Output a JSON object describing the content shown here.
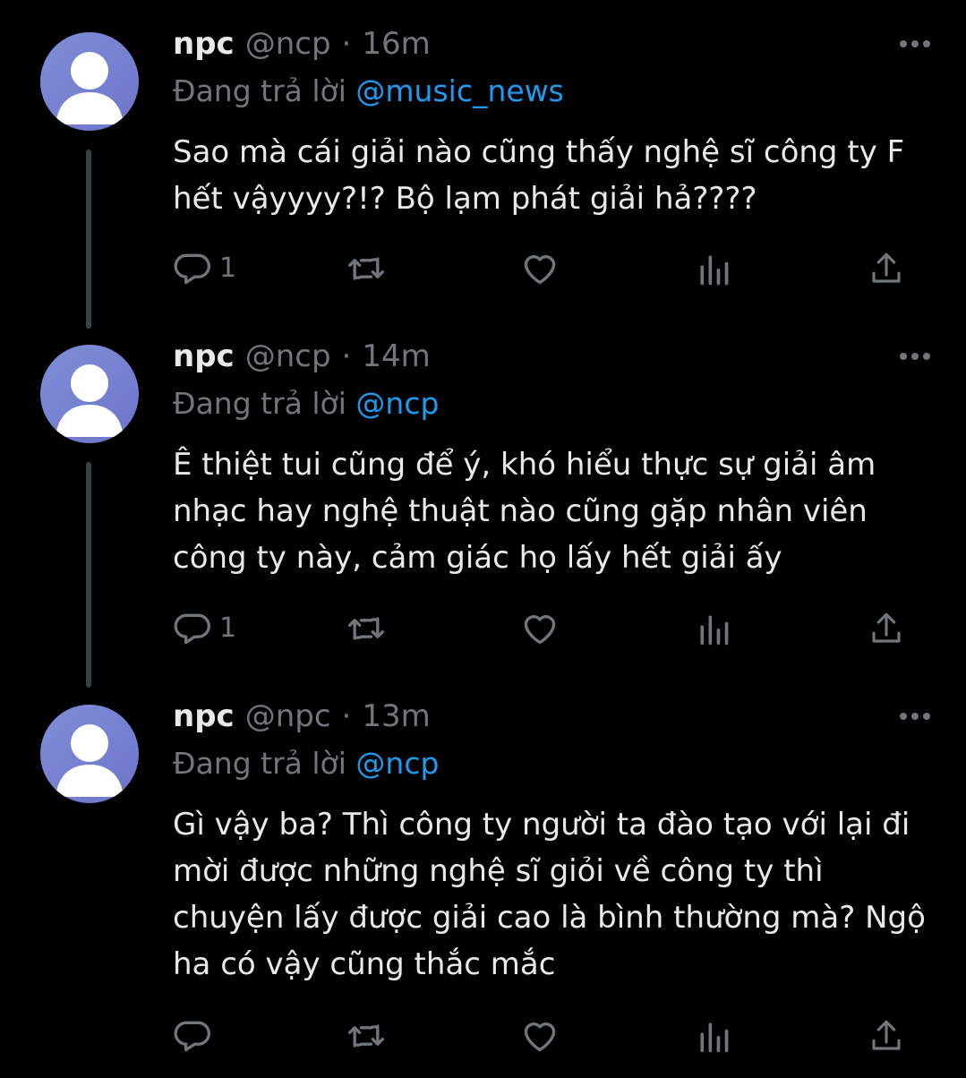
{
  "colors": {
    "background": "#000000",
    "text": "#e7e9ea",
    "muted": "#71767b",
    "link": "#1d9bf0",
    "thread_line": "#3b4045"
  },
  "tweets": [
    {
      "name": "npc",
      "handle": "@ncp",
      "separator": "·",
      "time": "16m",
      "reply_prefix": "Đang trả lời",
      "reply_to": "@music_news",
      "text": "Sao mà cái giải nào cũng thấy nghệ sĩ công ty F hết vậyyyy?!? Bộ lạm phát giải hả????",
      "actions": {
        "reply_icon": "reply-icon",
        "reply_count": "1",
        "retweet_icon": "retweet-icon",
        "like_icon": "heart-icon",
        "views_icon": "analytics-icon",
        "share_icon": "share-icon"
      }
    },
    {
      "name": "npc",
      "handle": "@ncp",
      "separator": "·",
      "time": "14m",
      "reply_prefix": "Đang trả lời",
      "reply_to": "@ncp",
      "text": "Ê thiệt tui cũng để ý, khó hiểu thực sự giải âm nhạc hay nghệ thuật nào cũng gặp nhân viên công ty này, cảm giác họ lấy hết giải ấy",
      "actions": {
        "reply_icon": "reply-icon",
        "reply_count": "1",
        "retweet_icon": "retweet-icon",
        "like_icon": "heart-icon",
        "views_icon": "analytics-icon",
        "share_icon": "share-icon"
      }
    },
    {
      "name": "npc",
      "handle": "@npc",
      "separator": "·",
      "time": "13m",
      "reply_prefix": "Đang trả lời",
      "reply_to": "@ncp",
      "text": "Gì vậy ba? Thì công ty người ta đào tạo với lại đi mời được những nghệ sĩ giỏi về công ty thì chuyện lấy được giải cao là bình thường mà? Ngộ ha có vậy cũng thắc mắc",
      "actions": {
        "reply_icon": "reply-icon",
        "reply_count": "",
        "retweet_icon": "retweet-icon",
        "like_icon": "heart-icon",
        "views_icon": "analytics-icon",
        "share_icon": "share-icon"
      }
    }
  ]
}
